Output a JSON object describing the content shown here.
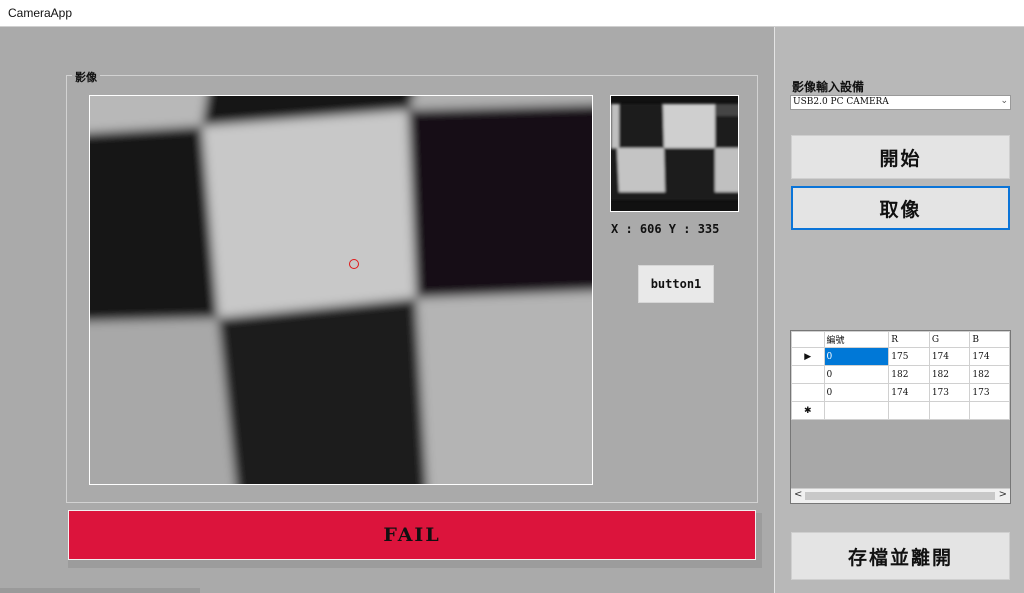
{
  "window": {
    "title": "CameraApp"
  },
  "preview": {
    "group_title": "影像",
    "coords_text": "X : 606 Y : 335",
    "button1_label": "button1",
    "result_text": "FAIL",
    "result_color": "#dc143c"
  },
  "sidebar": {
    "device_label": "影像輸入設備",
    "device_selected": "USB2.0 PC CAMERA",
    "start_label": "開始",
    "capture_label": "取像",
    "save_exit_label": "存檔並離開"
  },
  "grid": {
    "columns": [
      "編號",
      "R",
      "G",
      "B"
    ],
    "rows": [
      [
        "0",
        "175",
        "174",
        "174"
      ],
      [
        "0",
        "182",
        "182",
        "182"
      ],
      [
        "0",
        "174",
        "173",
        "173"
      ]
    ],
    "scroll_left": "<",
    "scroll_right": ">"
  },
  "icons": {
    "current_row": "▶",
    "new_row": "✱",
    "dropdown": "⌄"
  },
  "accent_color": "#0078d7"
}
